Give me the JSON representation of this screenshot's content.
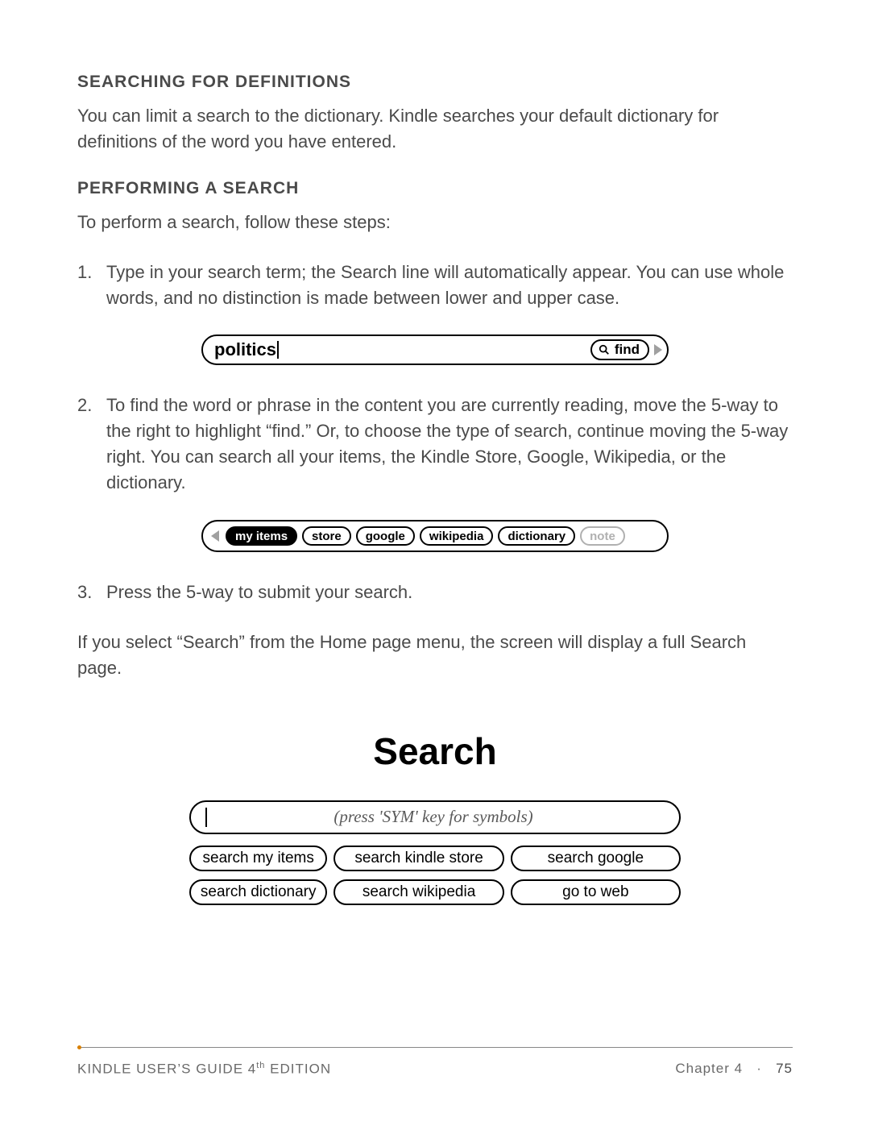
{
  "section1": {
    "heading": "SEARCHING FOR DEFINITIONS",
    "para": "You can limit a search to the dictionary. Kindle searches your default dictionary for definitions of the word you have entered."
  },
  "section2": {
    "heading": "PERFORMING A SEARCH",
    "intro": "To perform a search, follow these steps:"
  },
  "steps": {
    "s1_num": "1.",
    "s1_text": "Type in your search term; the Search line will automatically appear. You can use whole words, and no distinction is made between lower and upper case.",
    "s2_num": "2.",
    "s2_text": "To find the word or phrase in the content you are currently reading, move the 5-way to the right to highlight “find.” Or, to choose the type of search, continue moving the 5-way right. You can search all your items, the Kindle Store, Google, Wikipedia, or the dictionary.",
    "s3_num": "3.",
    "s3_text": "Press the 5-way to submit your search."
  },
  "search_bar": {
    "term": "politics",
    "find_label": "find"
  },
  "options": {
    "my_items": "my items",
    "store": "store",
    "google": "google",
    "wikipedia": "wikipedia",
    "dictionary": "dictionary",
    "note": "note"
  },
  "after_steps": "If you select “Search” from the Home page menu, the screen will display a full Search page.",
  "search_page": {
    "title": "Search",
    "placeholder": "(press 'SYM' key for symbols)",
    "btn1": "search my items",
    "btn2": "search kindle store",
    "btn3": "search google",
    "btn4": "search dictionary",
    "btn5": "search wikipedia",
    "btn6": "go to web"
  },
  "footer": {
    "left_a": "KINDLE USER’S GUIDE 4",
    "left_sup": "th",
    "left_b": " EDITION",
    "chapter": "Chapter 4",
    "dot": "·",
    "page": "75"
  }
}
